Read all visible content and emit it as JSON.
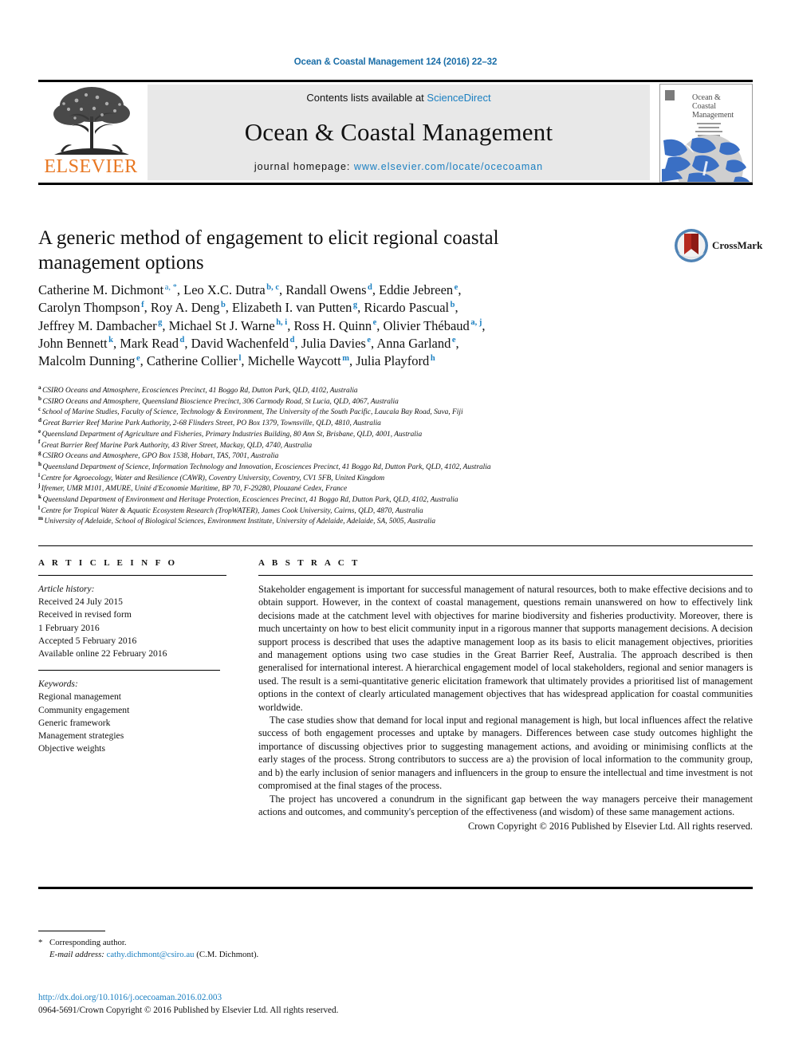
{
  "running_head": "Ocean & Coastal Management 124 (2016) 22–32",
  "masthead": {
    "publisher": "ELSEVIER",
    "contents_prefix": "Contents lists available at ",
    "contents_link": "ScienceDirect",
    "journal_title": "Ocean & Coastal Management",
    "homepage_prefix": "journal homepage: ",
    "homepage_url": "www.elsevier.com/locate/ocecoaman",
    "cover": {
      "line1": "Ocean &",
      "line2": "Coastal",
      "line3": "Management"
    }
  },
  "title": "A generic method of engagement to elicit regional coastal management options",
  "crossmark": {
    "label": "CrossMark"
  },
  "authors_lines": [
    [
      {
        "name": "Catherine M. Dichmont",
        "sup": "a, *"
      },
      {
        "name": ", Leo X.C. Dutra",
        "sup": "b, c"
      },
      {
        "name": ", Randall Owens",
        "sup": "d"
      },
      {
        "name": ", Eddie Jebreen",
        "sup": "e"
      },
      {
        "name": ","
      }
    ],
    [
      {
        "name": "Carolyn Thompson",
        "sup": "f"
      },
      {
        "name": ", Roy A. Deng",
        "sup": "b"
      },
      {
        "name": ", Elizabeth I. van Putten",
        "sup": "g"
      },
      {
        "name": ", Ricardo Pascual",
        "sup": "b"
      },
      {
        "name": ","
      }
    ],
    [
      {
        "name": "Jeffrey M. Dambacher",
        "sup": "g"
      },
      {
        "name": ", Michael St J. Warne",
        "sup": "h, i"
      },
      {
        "name": ", Ross H. Quinn",
        "sup": "e"
      },
      {
        "name": ", Olivier Thébaud",
        "sup": "a, j"
      },
      {
        "name": ","
      }
    ],
    [
      {
        "name": "John Bennett",
        "sup": "k"
      },
      {
        "name": ", Mark Read",
        "sup": "d"
      },
      {
        "name": ", David Wachenfeld",
        "sup": "d"
      },
      {
        "name": ", Julia Davies",
        "sup": "e"
      },
      {
        "name": ", Anna Garland",
        "sup": "e"
      },
      {
        "name": ","
      }
    ],
    [
      {
        "name": "Malcolm Dunning",
        "sup": "e"
      },
      {
        "name": ", Catherine Collier",
        "sup": "l"
      },
      {
        "name": ", Michelle Waycott",
        "sup": "m"
      },
      {
        "name": ", Julia Playford",
        "sup": "h"
      }
    ]
  ],
  "affiliations": [
    {
      "mark": "a",
      "text": "CSIRO Oceans and Atmosphere, Ecosciences Precinct, 41 Boggo Rd, Dutton Park, QLD, 4102, Australia"
    },
    {
      "mark": "b",
      "text": "CSIRO Oceans and Atmosphere, Queensland Bioscience Precinct, 306 Carmody Road, St Lucia, QLD, 4067, Australia"
    },
    {
      "mark": "c",
      "text": "School of Marine Studies, Faculty of Science, Technology & Environment, The University of the South Pacific, Laucala Bay Road, Suva, Fiji"
    },
    {
      "mark": "d",
      "text": "Great Barrier Reef Marine Park Authority, 2-68 Flinders Street, PO Box 1379, Townsville, QLD, 4810, Australia"
    },
    {
      "mark": "e",
      "text": "Queensland Department of Agriculture and Fisheries, Primary Industries Building, 80 Ann St, Brisbane, QLD, 4001, Australia"
    },
    {
      "mark": "f",
      "text": "Great Barrier Reef Marine Park Authority, 43 River Street, Mackay, QLD, 4740, Australia"
    },
    {
      "mark": "g",
      "text": "CSIRO Oceans and Atmosphere, GPO Box 1538, Hobart, TAS, 7001, Australia"
    },
    {
      "mark": "h",
      "text": "Queensland Department of Science, Information Technology and Innovation, Ecosciences Precinct, 41 Boggo Rd, Dutton Park, QLD, 4102, Australia"
    },
    {
      "mark": "i",
      "text": "Centre for Agroecology, Water and Resilience (CAWR), Coventry University, Coventry, CV1 5FB, United Kingdom"
    },
    {
      "mark": "j",
      "text": "Ifremer, UMR M101, AMURE, Unité d'Economie Maritime, BP 70, F-29280, Plouzané Cedex, France"
    },
    {
      "mark": "k",
      "text": "Queensland Department of Environment and Heritage Protection, Ecosciences Precinct, 41 Boggo Rd, Dutton Park, QLD, 4102, Australia"
    },
    {
      "mark": "l",
      "text": "Centre for Tropical Water & Aquatic Ecosystem Research (TropWATER), James Cook University, Cairns, QLD, 4870, Australia"
    },
    {
      "mark": "m",
      "text": "University of Adelaide, School of Biological Sciences, Environment Institute, University of Adelaide, Adelaide, SA, 5005, Australia"
    }
  ],
  "article_info": {
    "heading": "A R T I C L E   I N F O",
    "history_title": "Article history:",
    "history": [
      "Received 24 July 2015",
      "Received in revised form",
      "1 February 2016",
      "Accepted 5 February 2016",
      "Available online 22 February 2016"
    ],
    "keywords_title": "Keywords:",
    "keywords": [
      "Regional management",
      "Community engagement",
      "Generic framework",
      "Management strategies",
      "Objective weights"
    ]
  },
  "abstract": {
    "heading": "A B S T R A C T",
    "paragraphs": [
      "Stakeholder engagement is important for successful management of natural resources, both to make effective decisions and to obtain support. However, in the context of coastal management, questions remain unanswered on how to effectively link decisions made at the catchment level with objectives for marine biodiversity and fisheries productivity. Moreover, there is much uncertainty on how to best elicit community input in a rigorous manner that supports management decisions. A decision support process is described that uses the adaptive management loop as its basis to elicit management objectives, priorities and management options using two case studies in the Great Barrier Reef, Australia. The approach described is then generalised for international interest. A hierarchical engagement model of local stakeholders, regional and senior managers is used. The result is a semi-quantitative generic elicitation framework that ultimately provides a prioritised list of management options in the context of clearly articulated management objectives that has widespread application for coastal communities worldwide.",
      "The case studies show that demand for local input and regional management is high, but local influences affect the relative success of both engagement processes and uptake by managers. Differences between case study outcomes highlight the importance of discussing objectives prior to suggesting management actions, and avoiding or minimising conflicts at the early stages of the process. Strong contributors to success are a) the provision of local information to the community group, and b) the early inclusion of senior managers and influencers in the group to ensure the intellectual and time investment is not compromised at the final stages of the process.",
      "The project has uncovered a conundrum in the significant gap between the way managers perceive their management actions and outcomes, and community's perception of the effectiveness (and wisdom) of these same management actions."
    ],
    "copyright": "Crown Copyright © 2016 Published by Elsevier Ltd. All rights reserved."
  },
  "footnotes": {
    "corresponding": "Corresponding author.",
    "email_label": "E-mail address:",
    "email": "cathy.dichmont@csiro.au",
    "email_owner": "(C.M. Dichmont)."
  },
  "footer": {
    "doi": "http://dx.doi.org/10.1016/j.ocecoaman.2016.02.003",
    "issn_copyright": "0964-5691/Crown Copyright © 2016 Published by Elsevier Ltd. All rights reserved."
  },
  "colors": {
    "link_blue": "#1a7fc1",
    "elsevier_orange": "#e87722",
    "band_grey": "#e8e8e8"
  }
}
